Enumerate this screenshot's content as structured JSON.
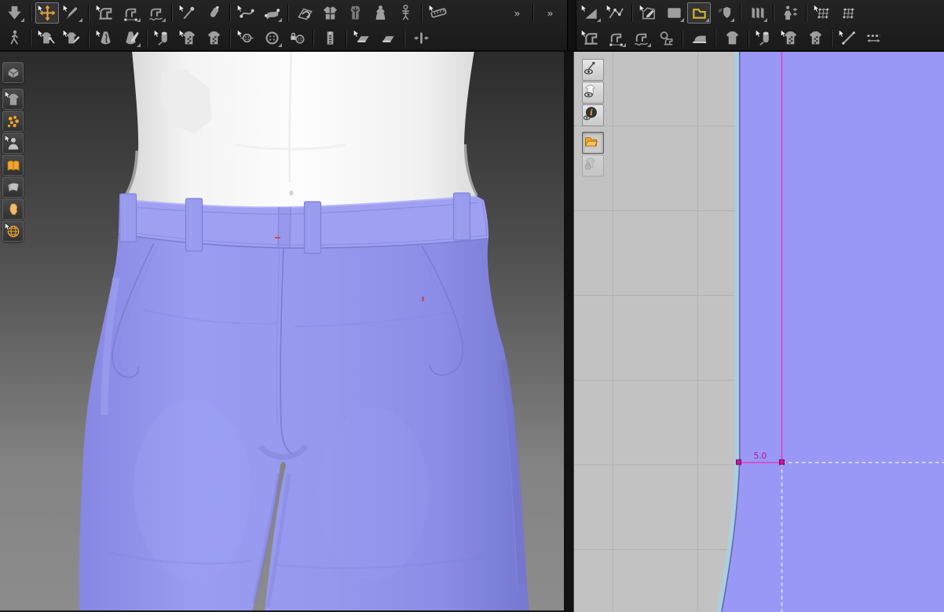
{
  "colors": {
    "toolbar_bg": "#1e1e1e",
    "accent_orange": "#e8a33d",
    "active_tool_yellow": "#d6b630",
    "icon_gray": "#9e9e9e",
    "viewport_bg_top": "#2b2b2b",
    "viewport_bg_bottom": "#8c8c8c",
    "avatar_skin": "#f5f5f5",
    "pants_base": "#9496ec",
    "pants_light": "#9a9cf0",
    "pants_shadow": "#7578d0",
    "pants_line": "#7a7cd2",
    "pattern_fill": "#9a98f6",
    "pattern_edge_blue": "#aacfe2",
    "pattern_edge_navy": "#5f6fae",
    "grid_bg": "#c2c2c2",
    "grid_line": "#b1b1b1",
    "measure_magenta": "#e23cc0",
    "measure_dark": "#b413a0",
    "guide_dash": "#e2e2fa",
    "stitch_red": "#c94040"
  },
  "toolbar": {
    "row1_left": [
      {
        "type": "tool",
        "name": "simulate-button",
        "glyph": "arrow-down",
        "submenu": true
      },
      {
        "type": "separator"
      },
      {
        "type": "tool",
        "name": "select-move-tool",
        "glyph": "move-cross",
        "cursor": true,
        "active": true
      },
      {
        "type": "tool",
        "name": "select-brush-tool",
        "glyph": "pen",
        "cursor": true,
        "submenu": true
      },
      {
        "type": "separator"
      },
      {
        "type": "tool",
        "name": "segment-sewing-tool",
        "glyph": "sewing",
        "cursor": true
      },
      {
        "type": "tool",
        "name": "free-sewing-tool",
        "glyph": "sewing-dots",
        "submenu": true
      },
      {
        "type": "tool",
        "name": "mn-sewing-tool",
        "glyph": "sewing-wave",
        "submenu": true
      },
      {
        "type": "separator"
      },
      {
        "type": "tool",
        "name": "pin-tool",
        "glyph": "pin",
        "cursor": true
      },
      {
        "type": "tool",
        "name": "tack-tool",
        "glyph": "tack"
      },
      {
        "type": "separator"
      },
      {
        "type": "tool",
        "name": "edit-curvature-tool",
        "glyph": "curve",
        "cursor": true
      },
      {
        "type": "tool",
        "name": "edit-curve-band-tool",
        "glyph": "curve-band",
        "submenu": true
      },
      {
        "type": "separator"
      },
      {
        "type": "tool",
        "name": "fold-arrangement-tool",
        "glyph": "fold"
      },
      {
        "type": "tool",
        "name": "reset-arrangement-button",
        "glyph": "shirt4"
      },
      {
        "type": "tool",
        "name": "avatar-display-button",
        "glyph": "mannequin"
      },
      {
        "type": "tool",
        "name": "show-avatar-button",
        "glyph": "avatar-body"
      },
      {
        "type": "tool",
        "name": "arrangement-points-button",
        "glyph": "skeleton"
      },
      {
        "type": "separator"
      },
      {
        "type": "tool",
        "name": "tape-measure-tool",
        "glyph": "tape",
        "cursor": true
      },
      {
        "type": "spacer"
      },
      {
        "type": "tool",
        "name": "overflow-left-button",
        "glyph": "chevrons"
      },
      {
        "type": "separator"
      },
      {
        "type": "tool",
        "name": "overflow-right-button",
        "glyph": "chevrons"
      }
    ],
    "row1_right": [
      {
        "type": "tool",
        "name": "transform-pattern-tool",
        "glyph": "tri-sel",
        "cursor": true,
        "submenu": true
      },
      {
        "type": "tool",
        "name": "edit-pattern-tool",
        "glyph": "polyline",
        "cursor": true
      },
      {
        "type": "separator"
      },
      {
        "type": "tool",
        "name": "add-point-tool",
        "glyph": "pen-poly",
        "cursor": true
      },
      {
        "type": "tool",
        "name": "rectangle-tool",
        "glyph": "rect-tool",
        "submenu": true
      },
      {
        "type": "tool",
        "name": "polygon-tool",
        "glyph": "poly-tool",
        "active": true,
        "tone": "yellow",
        "submenu": true
      },
      {
        "type": "tool",
        "name": "dart-tool",
        "glyph": "shield",
        "submenu": true
      },
      {
        "type": "separator"
      },
      {
        "type": "tool",
        "name": "pleats-tool",
        "glyph": "pleats",
        "submenu": true
      },
      {
        "type": "separator"
      },
      {
        "type": "tool",
        "name": "clone-layer-tool",
        "glyph": "avatar-dress"
      },
      {
        "type": "separator"
      },
      {
        "type": "tool",
        "name": "edit-texture-tool",
        "glyph": "grid",
        "cursor": true
      },
      {
        "type": "tool",
        "name": "edit-texture-all-tool",
        "glyph": "grid"
      }
    ],
    "row2_left": [
      {
        "type": "tool",
        "name": "avatar-pose-button",
        "glyph": "walk"
      },
      {
        "type": "separator"
      },
      {
        "type": "tool",
        "name": "edit-sewing-tool",
        "glyph": "shirt-needle",
        "cursor": true
      },
      {
        "type": "tool",
        "name": "edit-seamline-tool",
        "glyph": "shirt-pen",
        "cursor": true
      },
      {
        "type": "separator"
      },
      {
        "type": "tool",
        "name": "flatten-tool",
        "glyph": "dress-curve",
        "cursor": true
      },
      {
        "type": "tool",
        "name": "trace-tool",
        "glyph": "dress-knife",
        "submenu": true
      },
      {
        "type": "separator"
      },
      {
        "type": "tool",
        "name": "edit-texture-3d-tool",
        "glyph": "roll",
        "cursor": true
      },
      {
        "type": "tool",
        "name": "adjust-texture-tool",
        "glyph": "shirt-check",
        "cursor": true
      },
      {
        "type": "tool",
        "name": "texture-all-tool",
        "glyph": "shirt-check"
      },
      {
        "type": "separator"
      },
      {
        "type": "tool",
        "name": "select-button-tool",
        "glyph": "button-small",
        "cursor": true
      },
      {
        "type": "tool",
        "name": "button-tool",
        "glyph": "button",
        "submenu": true
      },
      {
        "type": "tool",
        "name": "buttonhole-lock-tool",
        "glyph": "button-lock"
      },
      {
        "type": "separator"
      },
      {
        "type": "tool",
        "name": "zipper-tool",
        "glyph": "zipper"
      },
      {
        "type": "separator"
      },
      {
        "type": "tool",
        "name": "seam-taping-tool",
        "glyph": "press-plane",
        "cursor": true
      },
      {
        "type": "tool",
        "name": "seam-taping-all-tool",
        "glyph": "press-plane"
      },
      {
        "type": "separator"
      },
      {
        "type": "tool",
        "name": "tuck-tool",
        "glyph": "pleat-arrows"
      }
    ],
    "row2_right": [
      {
        "type": "tool",
        "name": "edit-sewing-2d-tool",
        "glyph": "sewing",
        "cursor": true
      },
      {
        "type": "tool",
        "name": "free-sewing-2d-tool",
        "glyph": "sewing-dots",
        "submenu": true
      },
      {
        "type": "tool",
        "name": "mn-sewing-2d-tool",
        "glyph": "sewing-wave",
        "submenu": true
      },
      {
        "type": "tool",
        "name": "inspect-sewing-tool",
        "glyph": "magnifier-sew"
      },
      {
        "type": "separator"
      },
      {
        "type": "tool",
        "name": "press-seam-tool",
        "glyph": "iron"
      },
      {
        "type": "separator"
      },
      {
        "type": "tool",
        "name": "fit-garment-button",
        "glyph": "shirt"
      },
      {
        "type": "separator"
      },
      {
        "type": "tool",
        "name": "edit-texture-2d-tool",
        "glyph": "roll",
        "cursor": true
      },
      {
        "type": "tool",
        "name": "adjust-texture-2d-tool",
        "glyph": "shirt-check",
        "cursor": true
      },
      {
        "type": "tool",
        "name": "texture-all-2d-tool",
        "glyph": "shirt-check"
      },
      {
        "type": "separator"
      },
      {
        "type": "tool",
        "name": "internal-line-tool",
        "glyph": "line-tool",
        "cursor": true
      },
      {
        "type": "tool",
        "name": "basting-measure-tool",
        "glyph": "dash-measure"
      }
    ]
  },
  "sidebar3d": {
    "items": [
      {
        "name": "show-3d-view-toggle",
        "glyph": "cube"
      },
      {
        "name": "show-garment-toggle",
        "glyph": "shirt",
        "cursor": true,
        "gap_before": true
      },
      {
        "name": "show-arrangement-points-toggle",
        "glyph": "particles"
      },
      {
        "name": "show-avatar-toggle",
        "glyph": "person",
        "cursor": true
      },
      {
        "name": "fabric-library-toggle",
        "glyph": "book"
      },
      {
        "name": "show-fabric-toggle",
        "glyph": "fabric"
      },
      {
        "name": "show-avatar-head-toggle",
        "glyph": "head"
      },
      {
        "name": "show-environment-toggle",
        "glyph": "globe",
        "cursor": true
      }
    ]
  },
  "panel2d": {
    "sidebar": [
      {
        "name": "show-pins-toggle",
        "glyph": "eye-pin"
      },
      {
        "name": "show-silhouette-toggle",
        "glyph": "eye-shirt"
      },
      {
        "name": "show-pattern-info-toggle",
        "glyph": "info"
      },
      {
        "name": "show-base-pattern-toggle",
        "glyph": "folder-orange",
        "active": true,
        "gap_before": true
      },
      {
        "name": "lock-pattern-toggle",
        "glyph": "lock-shirt",
        "disabled": true
      }
    ],
    "measurement": {
      "label": "5.0"
    }
  }
}
